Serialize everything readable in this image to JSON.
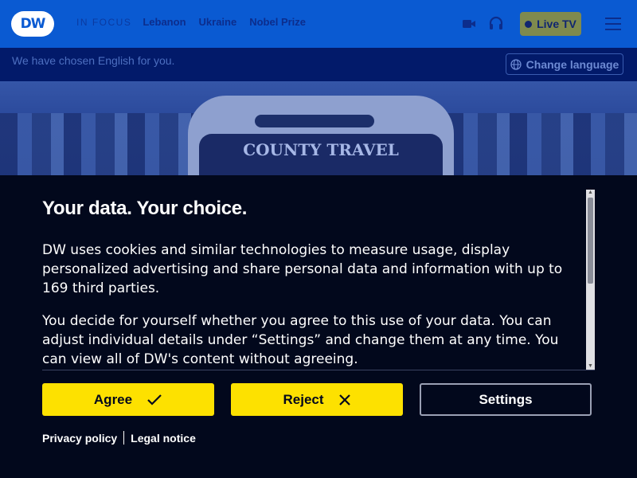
{
  "header": {
    "logo_text": "DW",
    "in_focus": "IN FOCUS",
    "topics": [
      "Lebanon",
      "Ukraine",
      "Nobel Prize"
    ],
    "live_tv": "Live TV",
    "icons": [
      "video-icon",
      "headphones-icon",
      "menu-icon"
    ]
  },
  "language_bar": {
    "message": "We have chosen English for you.",
    "change_language": "Change language"
  },
  "hero": {
    "bus_sign": "COUNTY TRAVEL"
  },
  "consent": {
    "title": "Your data. Your choice.",
    "paragraphs": [
      "DW uses cookies and similar technologies to measure usage, display personalized advertising and share personal data and information with up to 169 third parties.",
      "You decide for yourself whether you agree to this use of your data. You can adjust individual details under “Settings” and change them at any time. You can view all of DW's content without agreeing."
    ],
    "agree": "Agree",
    "reject": "Reject",
    "settings": "Settings",
    "privacy_policy": "Privacy policy",
    "legal_notice": "Legal notice"
  },
  "colors": {
    "brand_blue": "#0a5ad2",
    "yellow": "#fde100",
    "banner_bg": "#02081c"
  }
}
